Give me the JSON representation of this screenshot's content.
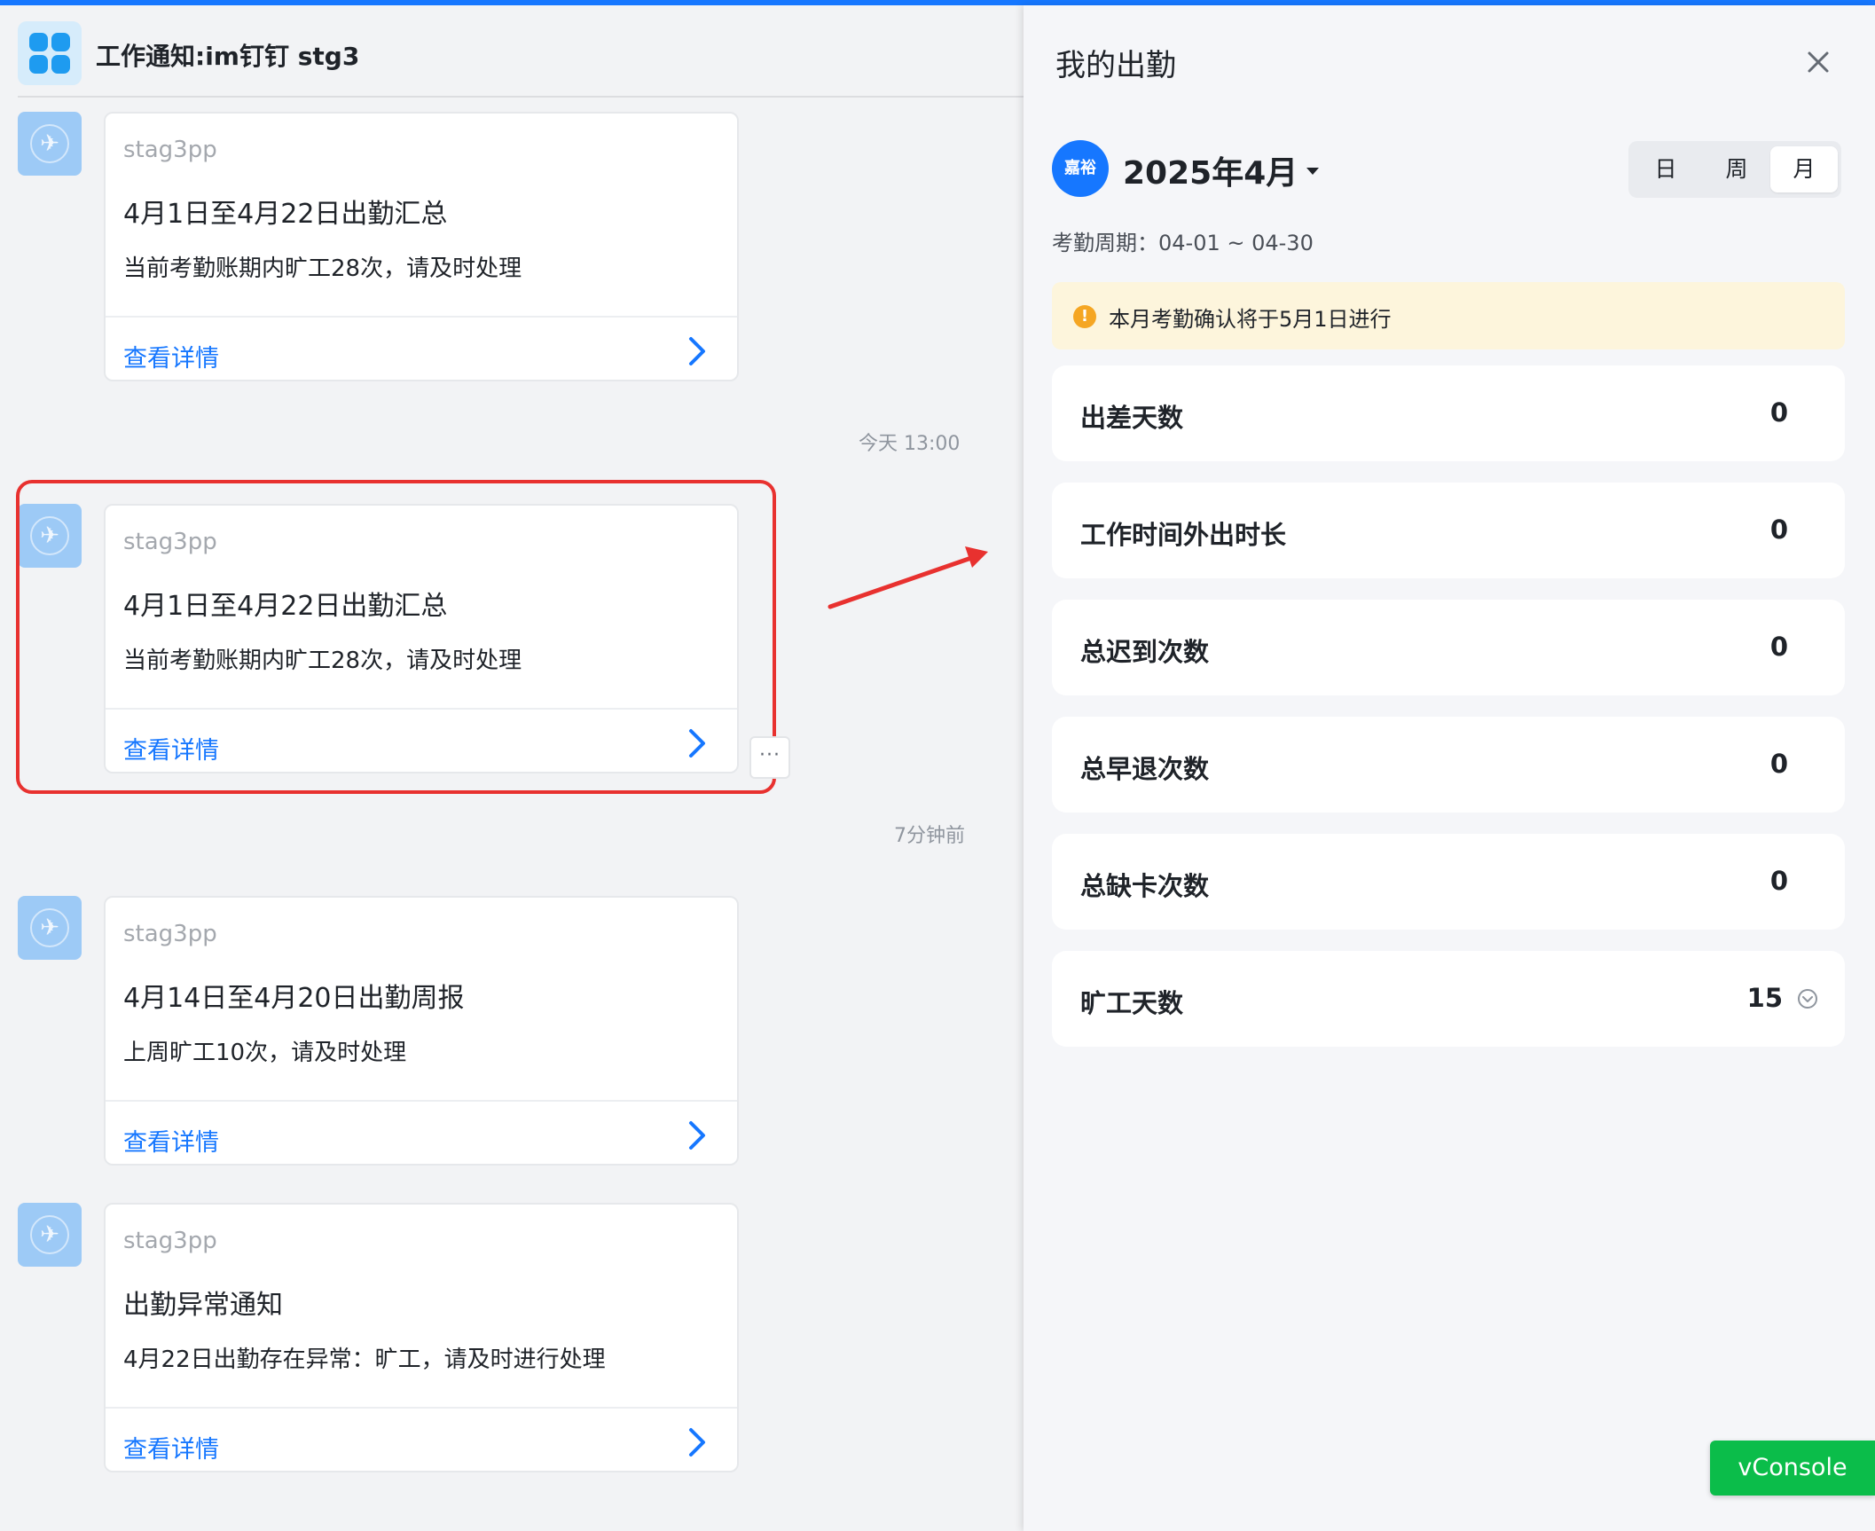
{
  "chat": {
    "title": "工作通知:im钉钉 stg3",
    "messages": [
      {
        "sender": "stag3pp",
        "title": "4月1日至4月22日出勤汇总",
        "body": "当前考勤账期内旷工28次，请及时处理",
        "link": "查看详情"
      },
      {
        "sender": "stag3pp",
        "title": "4月1日至4月22日出勤汇总",
        "body": "当前考勤账期内旷工28次，请及时处理",
        "link": "查看详情"
      },
      {
        "sender": "stag3pp",
        "title": "4月14日至4月20日出勤周报",
        "body": "上周旷工10次，请及时处理",
        "link": "查看详情"
      },
      {
        "sender": "stag3pp",
        "title": "出勤异常通知",
        "body": "4月22日出勤存在异常：旷工，请及时进行处理",
        "link": "查看详情"
      }
    ],
    "timestamps": [
      "今天 13:00",
      "7分钟前"
    ]
  },
  "panel": {
    "title": "我的出勤",
    "org_badge": "嘉裕",
    "month": "2025年4月",
    "tabs": [
      "日",
      "周",
      "月"
    ],
    "active_tab": "月",
    "period": "考勤周期：04-01 ~ 04-30",
    "notice": "本月考勤确认将于5月1日进行",
    "stats": [
      {
        "label": "出差天数",
        "value": "0"
      },
      {
        "label": "工作时间外出时长",
        "value": "0"
      },
      {
        "label": "总迟到次数",
        "value": "0"
      },
      {
        "label": "总早退次数",
        "value": "0"
      },
      {
        "label": "总缺卡次数",
        "value": "0"
      },
      {
        "label": "旷工天数",
        "value": "15"
      }
    ]
  },
  "vconsole": "vConsole",
  "colors": {
    "accent": "#1677ff",
    "highlight": "#e8312f",
    "vconsole": "#0bbd4a",
    "notice_bg": "#fdf5dc"
  }
}
